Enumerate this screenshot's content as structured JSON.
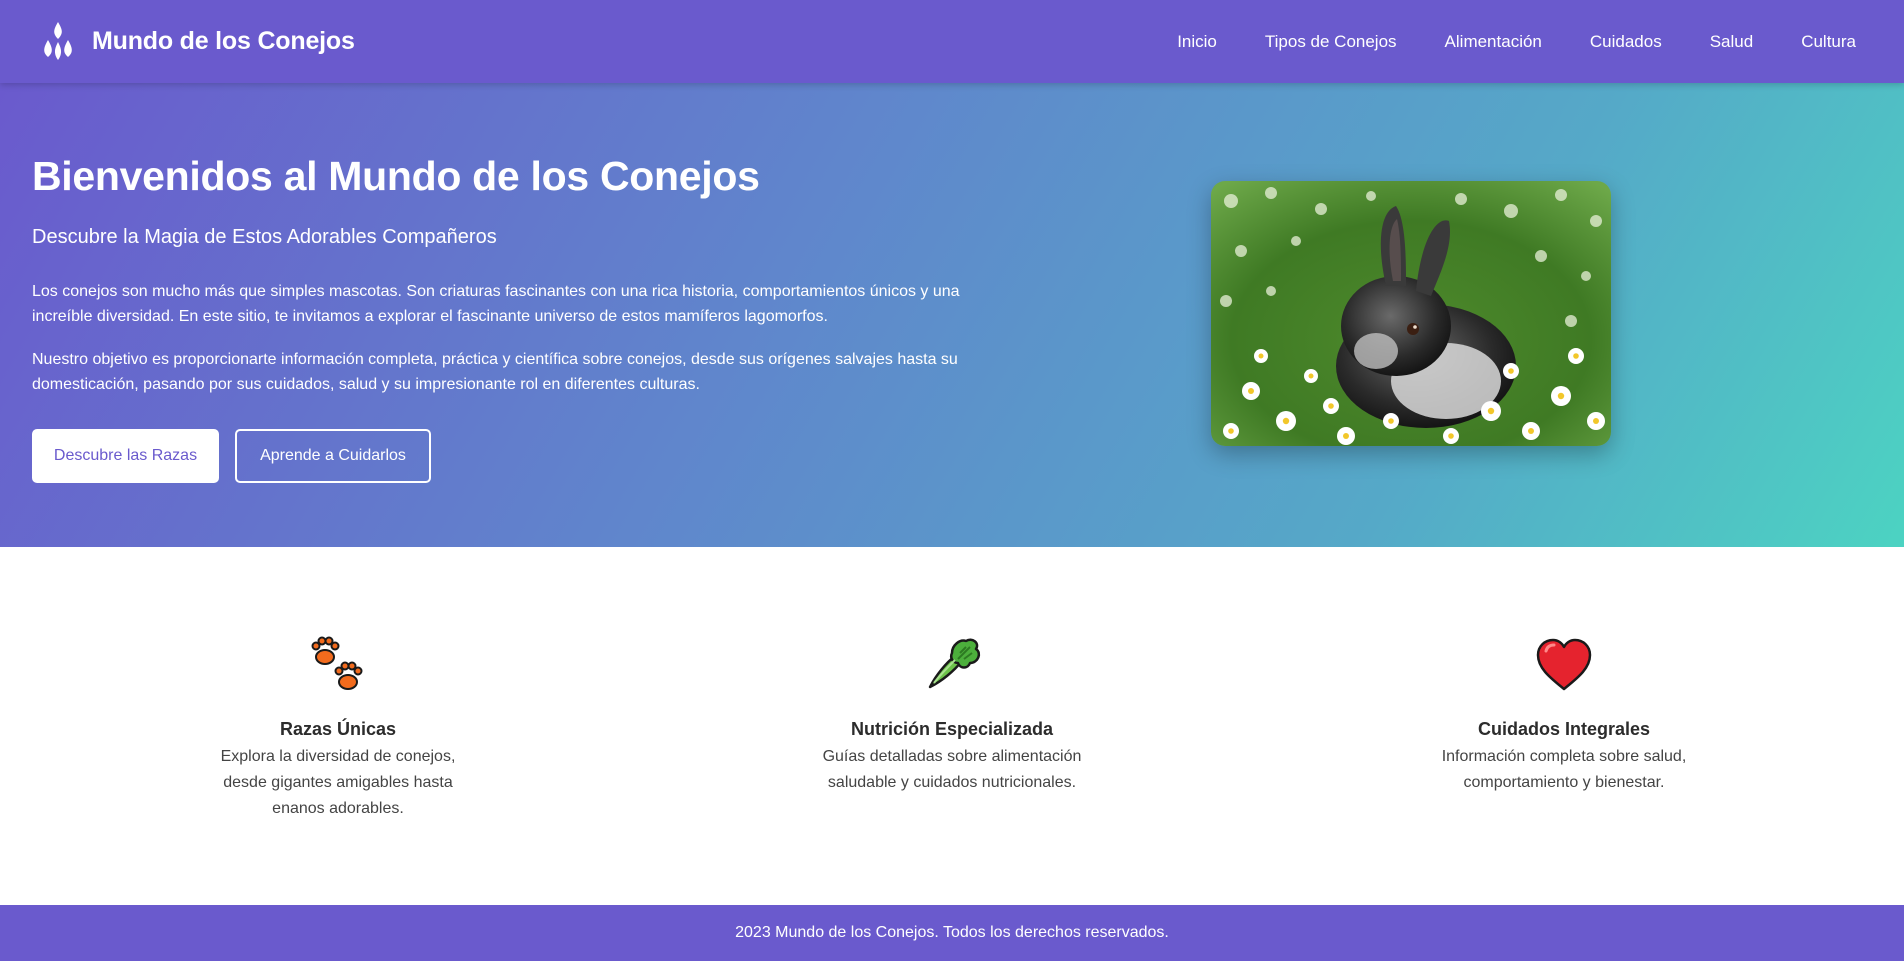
{
  "brand": {
    "name": "Mundo de los Conejos",
    "icon": "rabbit-logo-icon"
  },
  "nav": [
    {
      "label": "Inicio"
    },
    {
      "label": "Tipos de Conejos"
    },
    {
      "label": "Alimentación"
    },
    {
      "label": "Cuidados"
    },
    {
      "label": "Salud"
    },
    {
      "label": "Cultura"
    }
  ],
  "hero": {
    "title": "Bienvenidos al Mundo de los Conejos",
    "subtitle": "Descubre la Magia de Estos Adorables Compañeros",
    "paragraph1": "Los conejos son mucho más que simples mascotas. Son criaturas fascinantes con una rica historia, comportamientos únicos y una increíble diversidad. En este sitio, te invitamos a explorar el fascinante universo de estos mamíferos lagomorfos.",
    "paragraph2": "Nuestro objetivo es proporcionarte información completa, práctica y científica sobre conejos, desde sus orígenes salvajes hasta su domesticación, pasando por sus cuidados, salud y su impresionante rol en diferentes culturas.",
    "primary_button": "Descubre las Razas",
    "secondary_button": "Aprende a Cuidarlos"
  },
  "features": [
    {
      "icon": "paw-prints-icon",
      "title": "Razas Únicas",
      "description": "Explora la diversidad de conejos, desde gigantes amigables hasta enanos adorables."
    },
    {
      "icon": "leafy-green-icon",
      "title": "Nutrición Especializada",
      "description": "Guías detalladas sobre alimentación saludable y cuidados nutricionales."
    },
    {
      "icon": "red-heart-icon",
      "title": "Cuidados Integrales",
      "description": "Información completa sobre salud, comportamiento y bienestar."
    }
  ],
  "footer": {
    "text": "2023 Mundo de los Conejos. Todos los derechos reservados."
  },
  "colors": {
    "primary": "#6a5acd",
    "gradient_end": "#4cd3c2",
    "text_dark": "#2c2c2c"
  }
}
